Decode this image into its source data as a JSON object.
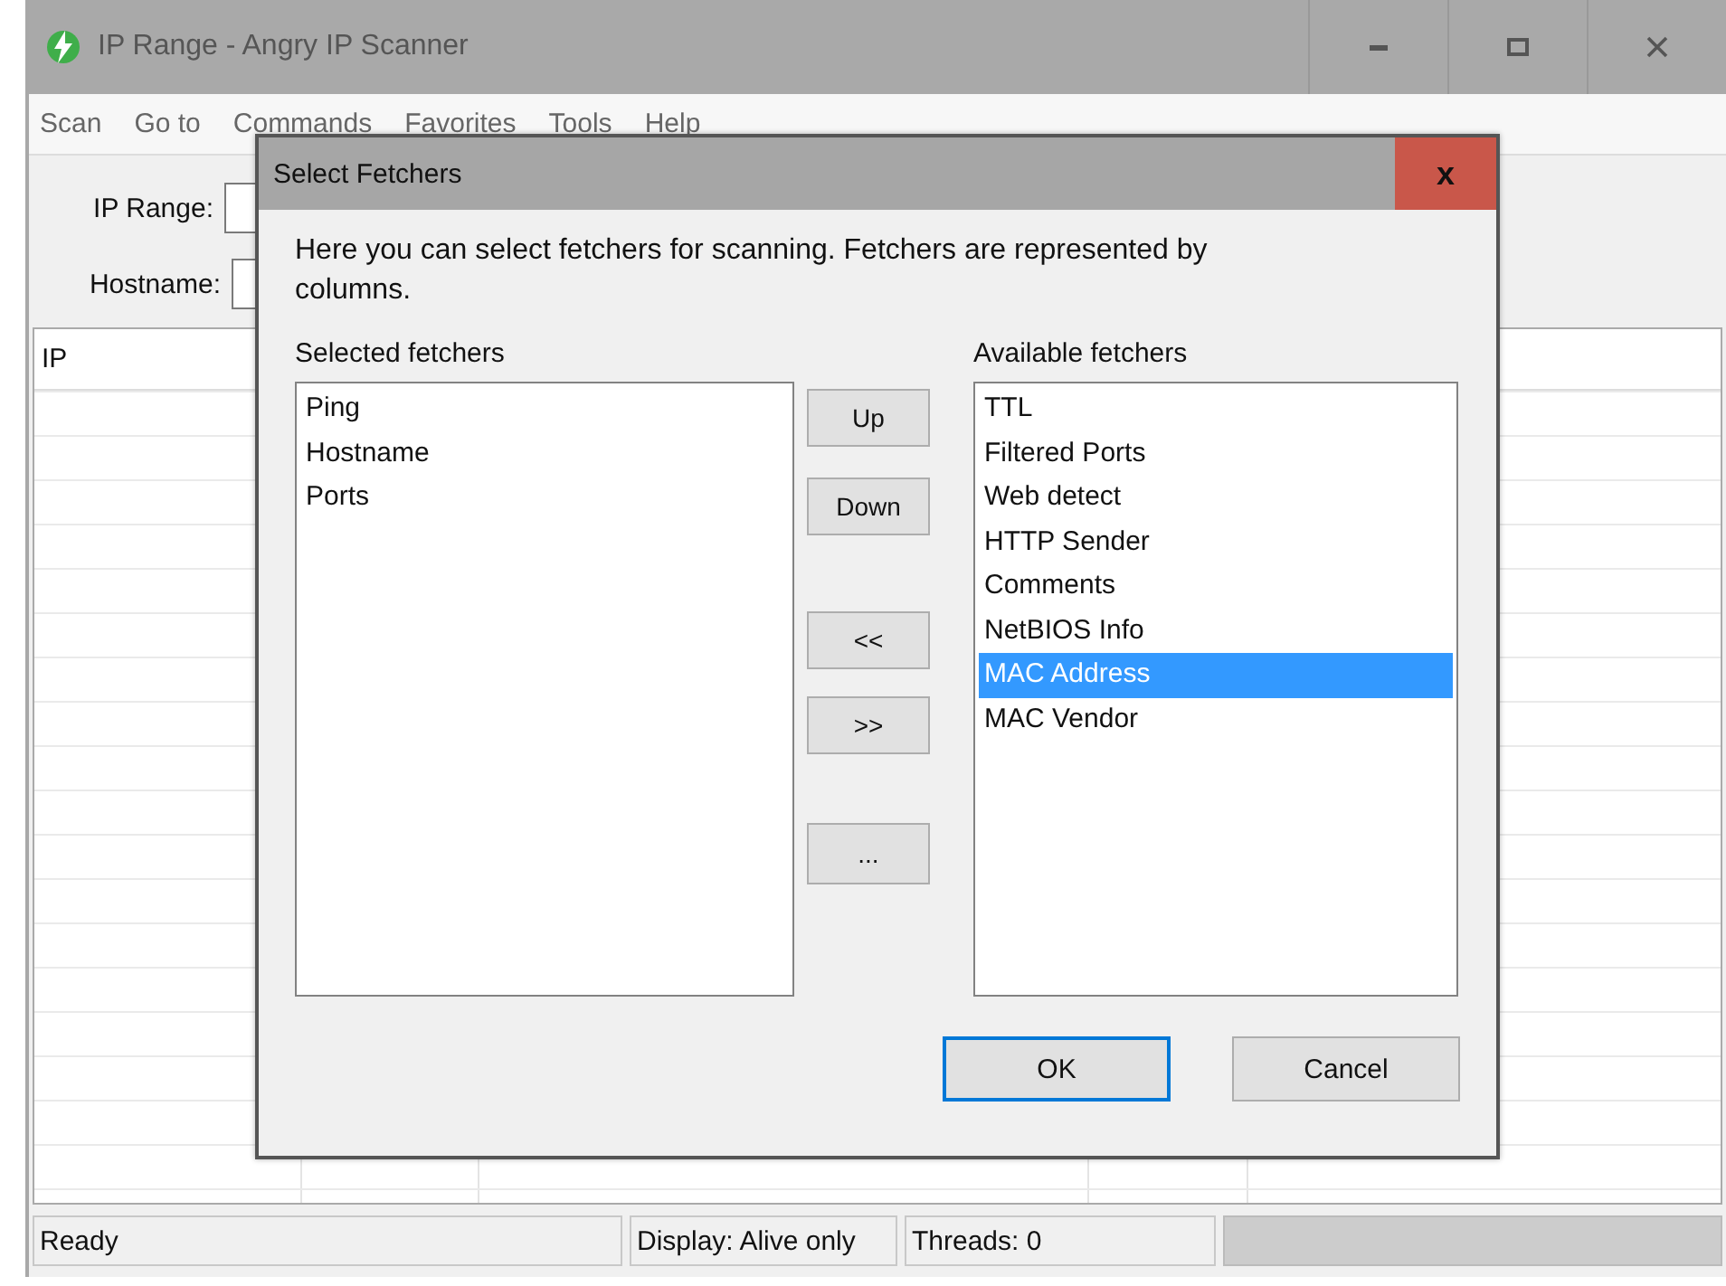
{
  "window": {
    "title": "IP Range - Angry IP Scanner"
  },
  "menu": [
    {
      "label": "Scan"
    },
    {
      "label": "Go to"
    },
    {
      "label": "Commands"
    },
    {
      "label": "Favorites"
    },
    {
      "label": "Tools"
    },
    {
      "label": "Help"
    }
  ],
  "fields": [
    {
      "label": "IP Range:"
    },
    {
      "label": "Hostname:"
    }
  ],
  "table": {
    "columns": [
      "IP"
    ]
  },
  "dialog": {
    "title": "Select Fetchers",
    "close": "x",
    "description": "Here you can select fetchers for scanning. Fetchers are represented by columns.",
    "selected_label": "Selected fetchers",
    "selected_fetchers": [
      {
        "label": "Ping",
        "selected": false
      },
      {
        "label": "Hostname",
        "selected": false
      },
      {
        "label": "Ports",
        "selected": false
      }
    ],
    "move_buttons": [
      "Up",
      "Down",
      "<<",
      ">>",
      "..."
    ],
    "available_label": "Available fetchers",
    "available_fetchers": [
      {
        "label": "TTL",
        "selected": false
      },
      {
        "label": "Filtered Ports",
        "selected": false
      },
      {
        "label": "Web detect",
        "selected": false
      },
      {
        "label": "HTTP Sender",
        "selected": false
      },
      {
        "label": "Comments",
        "selected": false
      },
      {
        "label": "NetBIOS Info",
        "selected": false
      },
      {
        "label": "MAC Address",
        "selected": true
      },
      {
        "label": "MAC Vendor",
        "selected": false
      }
    ],
    "buttons": [
      {
        "label": "OK",
        "default": true
      },
      {
        "label": "Cancel",
        "default": false
      }
    ]
  },
  "status_bar": {
    "items": [
      "Ready",
      "Display: Alive only",
      "Threads: 0"
    ]
  }
}
